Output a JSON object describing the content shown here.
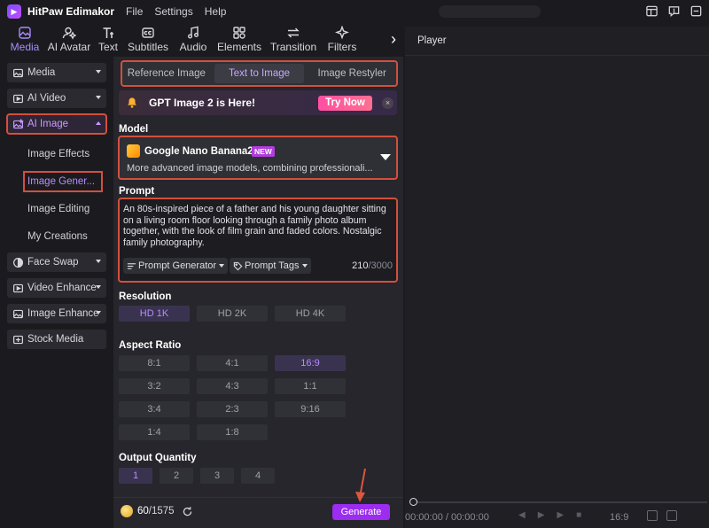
{
  "app": {
    "name": "HitPaw Edimakor",
    "menu": [
      "File",
      "Settings",
      "Help"
    ]
  },
  "tooltabs": [
    {
      "label": "Media",
      "icon": "media-icon",
      "active": true
    },
    {
      "label": "AI Avatar",
      "icon": "avatar-icon"
    },
    {
      "label": "Text",
      "icon": "text-icon"
    },
    {
      "label": "Subtitles",
      "icon": "subtitles-icon"
    },
    {
      "label": "Audio",
      "icon": "audio-icon"
    },
    {
      "label": "Elements",
      "icon": "elements-icon"
    },
    {
      "label": "Transition",
      "icon": "transition-icon"
    },
    {
      "label": "Filters",
      "icon": "filters-icon"
    }
  ],
  "sidebar": {
    "categories": {
      "media": "Media",
      "ai_video": "AI Video",
      "ai_image": "AI Image",
      "face_swap": "Face Swap",
      "video_enhance": "Video Enhance",
      "image_enhance": "Image Enhance",
      "stock_media": "Stock Media"
    },
    "sub_items": {
      "image_effects": "Image Effects",
      "image_generator": "Image Gener...",
      "image_editing": "Image Editing",
      "my_creations": "My Creations"
    }
  },
  "panel": {
    "segments": [
      "Reference Image",
      "Text to Image",
      "Image Restyler"
    ],
    "banner": {
      "text": "GPT Image 2 is Here!",
      "button": "Try Now",
      "close": "×"
    },
    "model_label": "Model",
    "model": {
      "name": "Google Nano Banana2",
      "badge": "NEW",
      "description": "More advanced image models, combining professionali..."
    },
    "prompt_label": "Prompt",
    "prompt": {
      "text": "An 80s-inspired piece of a father and his young daughter sitting on a living room floor looking through a family photo album together, with the look of film grain and faded colors. Nostalgic family photography.",
      "generator": "Prompt Generator",
      "tags": "Prompt Tags",
      "count": "210",
      "max": "/3000"
    },
    "resolution_label": "Resolution",
    "resolutions": [
      "HD 1K",
      "HD 2K",
      "HD 4K"
    ],
    "aspect_label": "Aspect Ratio",
    "aspects": [
      "8:1",
      "4:1",
      "16:9",
      "3:2",
      "4:3",
      "1:1",
      "3:4",
      "2:3",
      "9:16",
      "1:4",
      "1:8"
    ],
    "quantity_label": "Output Quantity",
    "quantities": [
      "1",
      "2",
      "3",
      "4"
    ],
    "credits": {
      "used": "60",
      "total": "/1575"
    },
    "generate": "Generate"
  },
  "player": {
    "title": "Player",
    "time": "00:00:00 / 00:00:00",
    "ratio": "16:9"
  },
  "colors": {
    "accent": "#a88bff",
    "highlight": "#d2503d",
    "generate": "#9b2cf0",
    "trynow": "#ff5a99"
  }
}
